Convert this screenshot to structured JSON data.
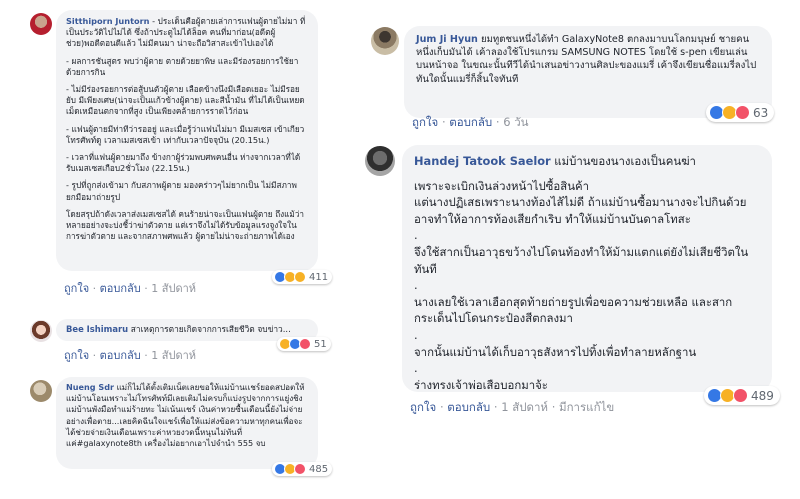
{
  "comments": [
    {
      "name": "Sitthiporn Juntorn",
      "paragraphs": [
        " - ประเด็นคือผู้ตายเล่าการแฟนผู้ตายไม่มา ที่เป็นประวัติไปไม่ได้ ซึ่งถ้าประตูไม่ได้ล็อค คนที่มาก่อน(อดีตผู้ช่วย)พอดีตอนดีแล้ว ไม่มีคนมา น่าจะถือวิสาสะเข้าไปเองได้",
        "- ผลการชันสูตร พบว่าผู้ตาย ตายด้วยยาพิษ และมีร่องรอยการใช้ยาด้วยการกิน",
        "- ไม่มีร่องรอยการต่อสู้บนตัวผู้ตาย เลือดข้างนึงมีเลือดเยอะ ไม่มีรอยยับ มีเพียงเศษ(น่าจะเป็นแก้วข้างผู้ตาย) และสีน้ำมัน ที่ไม่ได้เป็นเหยดเม็ดเหมือนตกจากที่สูง เป็นเพียงคล้ายการราดไว้ก่อน",
        "- แฟนผู้ตายมีท่าทีว่ารออยู่ และเมื่อรู้ว่าแฟนไม่มา มีเมสเซส เข้าเกียว โทรศัพท์ดู เวลาเมสเซสเข้า เท่ากับเวลาปัจจุบัน (20.15น.)",
        "- เวลาที่แฟนผู้ตายมาถึง ข้างกาผู้ร่วมพบศพคนอื่น ห่างจากเวลาที่ได้รับเมสเซสเกือบ2ชั่วโมง (22.15น.)",
        "- รูปที่ถูกส่งเข้ามา กับสภาพผู้ตาย มองคร่าวๆไม่ยากเป็น ไม่มีสภาพยกมือมาถ่ายรูป",
        "โดยสรุปถ้าดังเวลาส่งเมสเซสได้ คนร้ายน่าจะเป็นแฟนผู้ตาย ถึงแม้ว่าหลายอย่างจะบ่งชี้ว่าฆ่าตัวตาย แต่เราจึงไม่ได้รับข้อมูลแรงจูงใจในการฆ่าตัวตาย และจากสภาพศพแล้ว ผู้ตายไม่น่าจะถ่ายภาพได้เอง"
      ],
      "reaction_count": "411",
      "like_label": "ถูกใจ",
      "reply_label": "ตอบกลับ",
      "time": "1 สัปดาห์"
    },
    {
      "name": "Bee Ishimaru",
      "text": "สาเหตุการตายเกิดจากการเสียชีวิต จบข่าว...",
      "reaction_count": "51",
      "like_label": "ถูกใจ",
      "reply_label": "ตอบกลับ",
      "time": "1 สัปดาห์"
    },
    {
      "name": "Nueng Sdr",
      "text": "แม่ก็ไม่ได้ตั้งเติมเน็ตเลยขอให้แม่บ้านเเชร์ยอดสปอตให้แม่บ้านโอนเพราะไม่โทรศัพท์มีเลยเติมไม่ครบก็แบ่งรูปจากการแยู่งชิงแม่บ้านพังมือทำแม่ร้ายทะ ไม่เน้นแชร์ เงินค่าหวยซื้นเดือนนี้ยังไม่จ่ายอย่างเพื่อตาย...เลยคิดฉีนใจเเชร์เพื่อให้แม่ส่งข้อความหาทุกคนเพื่อจะได้ช่วยจ่ายเงินเดือนเพราะค่าหวยงวดนี้หนุนไม่ทันที่แค่#galaxynote8th เครื่องไม่อยากเอาไปจำนำ 555 จบ",
      "reaction_count": "485"
    },
    {
      "name": "Jum Ji Hyun",
      "text": "ยมทูตชนหนึ่งได้ทำ GalaxyNote8 ตกลงมาบนโลกมนุษย์ ชายคนหนึ่งเก็บมันได้ เค้าลองใช้โปรแกรม SAMSUNG NOTES โดยใช้ s-pen เขียนเล่นบนหน้าจอ ในขณะนั้นทีวีได้นำเสนอข่าวงานศิลปะของแมรี่ เค้าจึงเขียนชื่อแมรี่ลงไป ทันใดนั้นแมรี่ก็สิ้นใจทันที",
      "reaction_count": "63",
      "like_label": "ถูกใจ",
      "reply_label": "ตอบกลับ",
      "time": "6 วัน"
    },
    {
      "name": "Handej Tatook Saelor",
      "first_line": "แม่บ้านของนางเองเป็นคนฆ่า",
      "lines": [
        "เพราะจะเบิกเงินล่วงหน้าไปซื้อสินค้า",
        "แต่นางปฏิเสธเพราะนางท้องไส้ไม่ดี ถ้าแม่บ้านซื้อมานางจะไปกินด้วย อาจทำให้อาการท้องเสียกำเริบ ทำให้แม่บ้านบันดาลโทสะ",
        ".",
        "จึงใช้สากเป็นอาวุธขว้างไปโดนท้องทำให้ม้ามแตกแต่ยังไม่เสียชีวิตในทันที",
        ".",
        "นางเลยใช้เวลาเฮือกสุดท้ายถ่ายรูปเพื่อขอความช่วยเหลือ และสากกระเด็นไปโดนกระป๋องสีตกลงมา",
        ".",
        "จากนั้นแม่บ้านได้เก็บอาวุธสังหารไปทิ้งเพื่อทำลายหลักฐาน",
        ".",
        "ร่างทรงเจ้าพ่อเสือบอกมาจ้ะ"
      ],
      "reaction_count": "489",
      "like_label": "ถูกใจ",
      "reply_label": "ตอบกลับ",
      "time": "1 สัปดาห์",
      "edited_label": "มีการแก้ไข"
    }
  ],
  "colors": {
    "name": "#385898",
    "bubble": "#f2f3f5",
    "meta": "#90949c",
    "like": "#3578e5",
    "love": "#f25268",
    "haha": "#f7b125"
  },
  "icons": [
    "like-reaction-icon",
    "love-reaction-icon",
    "haha-reaction-icon",
    "sad-reaction-icon"
  ]
}
